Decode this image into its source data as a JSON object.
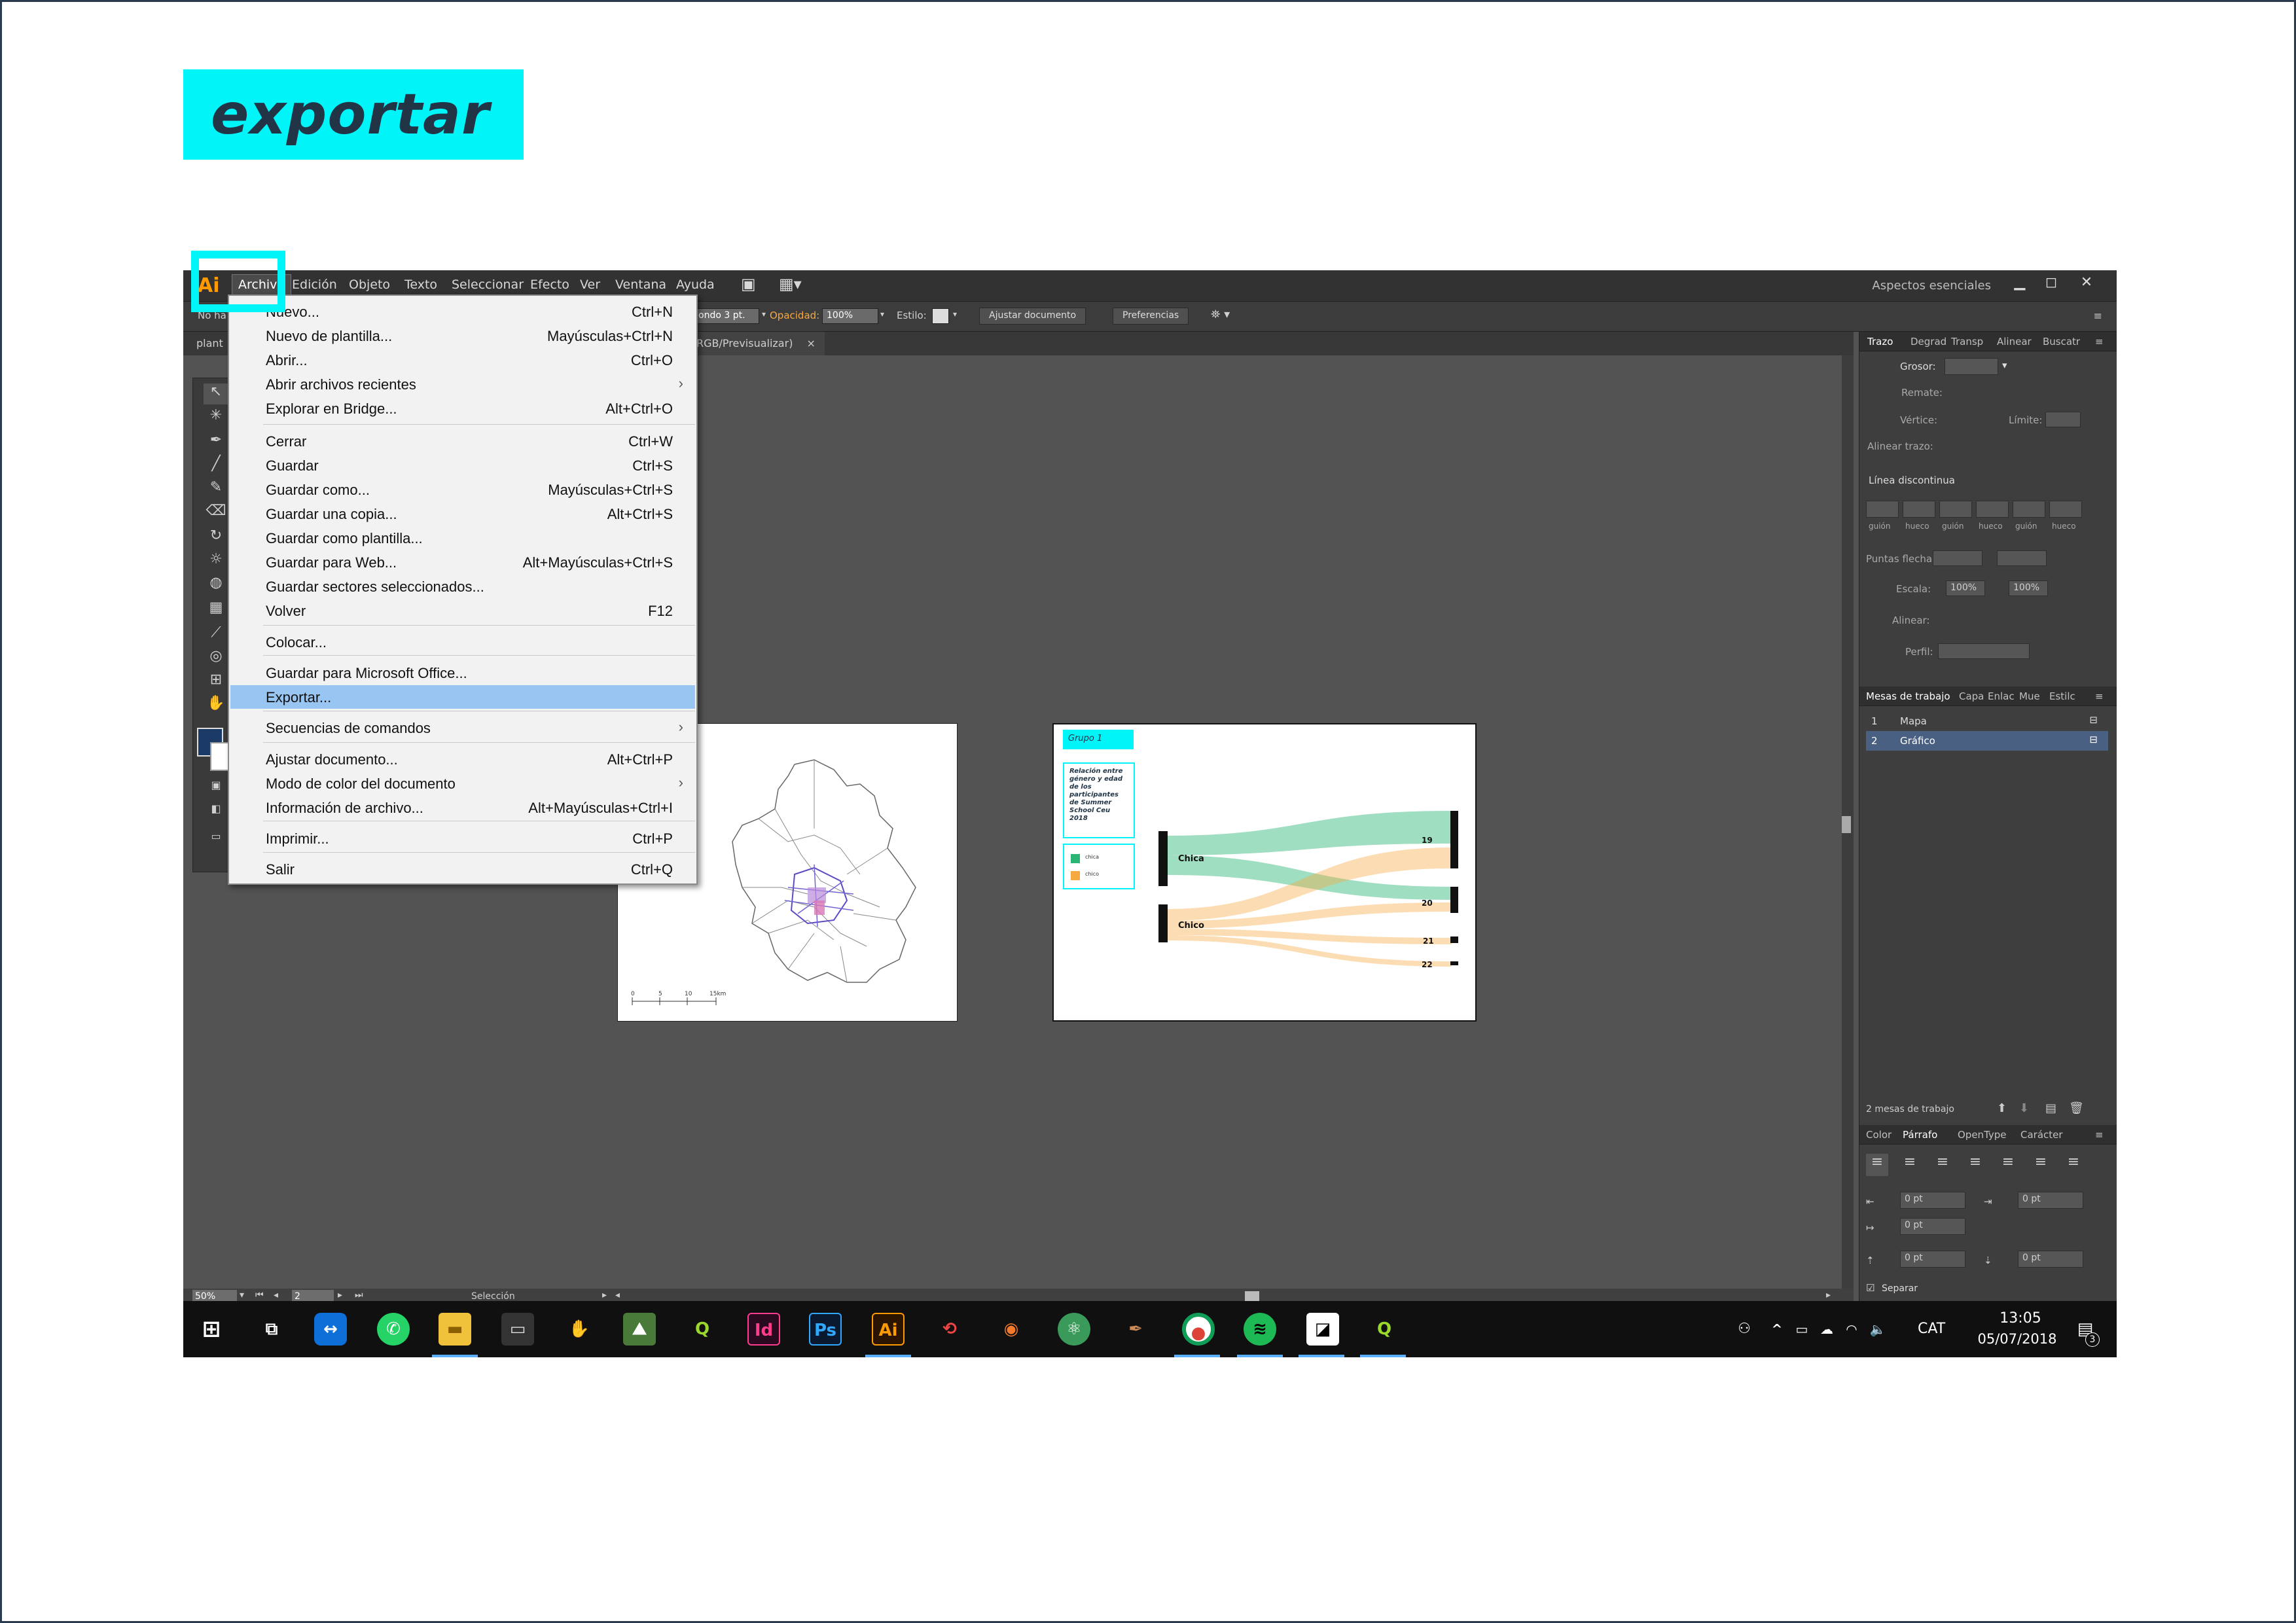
{
  "title": "exportar",
  "menubar": {
    "logo": "Ai",
    "items": [
      "Archivo",
      "Edición",
      "Objeto",
      "Texto",
      "Seleccionar",
      "Efecto",
      "Ver",
      "Ventana",
      "Ayuda"
    ],
    "workspace": "Aspectos esenciales"
  },
  "control_bar": {
    "left_label": "No ha",
    "stroke_value": "ondo 3 pt.",
    "opacity_label": "Opacidad:",
    "opacity_value": "100%",
    "style_label": "Estilo:",
    "fit_doc_button": "Ajustar documento",
    "prefs_button": "Preferencias"
  },
  "doc_tab": {
    "left_label": "plant",
    "title": "RGB/Previsualizar)",
    "close": "×"
  },
  "file_menu": [
    {
      "label": "Nuevo...",
      "shortcut": "Ctrl+N"
    },
    {
      "label": "Nuevo de plantilla...",
      "shortcut": "Mayúsculas+Ctrl+N"
    },
    {
      "label": "Abrir...",
      "shortcut": "Ctrl+O"
    },
    {
      "label": "Abrir archivos recientes",
      "shortcut": "",
      "submenu": true
    },
    {
      "label": "Explorar en Bridge...",
      "shortcut": "Alt+Ctrl+O"
    },
    {
      "label": "Cerrar",
      "shortcut": "Ctrl+W"
    },
    {
      "label": "Guardar",
      "shortcut": "Ctrl+S"
    },
    {
      "label": "Guardar como...",
      "shortcut": "Mayúsculas+Ctrl+S"
    },
    {
      "label": "Guardar una copia...",
      "shortcut": "Alt+Ctrl+S"
    },
    {
      "label": "Guardar como plantilla...",
      "shortcut": ""
    },
    {
      "label": "Guardar para Web...",
      "shortcut": "Alt+Mayúsculas+Ctrl+S"
    },
    {
      "label": "Guardar sectores seleccionados...",
      "shortcut": ""
    },
    {
      "label": "Volver",
      "shortcut": "F12"
    },
    {
      "label": "Colocar...",
      "shortcut": ""
    },
    {
      "label": "Guardar para Microsoft Office...",
      "shortcut": ""
    },
    {
      "label": "Exportar...",
      "shortcut": "",
      "highlight": true
    },
    {
      "label": "Secuencias de comandos",
      "shortcut": "",
      "submenu": true
    },
    {
      "label": "Ajustar documento...",
      "shortcut": "Alt+Ctrl+P"
    },
    {
      "label": "Modo de color del documento",
      "shortcut": "",
      "submenu": true
    },
    {
      "label": "Información de archivo...",
      "shortcut": "Alt+Mayúsculas+Ctrl+I"
    },
    {
      "label": "Imprimir...",
      "shortcut": "Ctrl+P"
    },
    {
      "label": "Salir",
      "shortcut": "Ctrl+Q"
    }
  ],
  "artboard1": {
    "scale_labels": [
      "0",
      "5",
      "10",
      "15km"
    ]
  },
  "artboard2": {
    "group_title": "Grupo 1",
    "description": "Relación entre género y edad de los participantes de Summer School Ceu 2018",
    "legend": [
      {
        "label": "chica",
        "color": "#2bb673"
      },
      {
        "label": "chico",
        "color": "#f7a941"
      }
    ],
    "sankey_sources": [
      "Chica",
      "Chico"
    ],
    "sankey_targets": [
      "19",
      "20",
      "21",
      "22"
    ]
  },
  "stroke_panel": {
    "tabs": [
      "Trazo",
      "Degrad",
      "Transp",
      "Alinear",
      "Buscatr"
    ],
    "weight_label": "Grosor:",
    "cap_label": "Remate:",
    "corner_label": "Vértice:",
    "limit_label": "Límite:",
    "align_label": "Alinear trazo:",
    "dashed_label": "Línea discontinua",
    "dash_labels": [
      "guión",
      "hueco",
      "guión",
      "hueco",
      "guión",
      "hueco"
    ],
    "arrow_label": "Puntas flecha:",
    "scale_label": "Escala:",
    "scale_values": [
      "100%",
      "100%"
    ],
    "align2_label": "Alinear:",
    "profile_label": "Perfil:"
  },
  "artboards_panel": {
    "tabs": [
      "Mesas de trabajo",
      "Capa",
      "Enlac",
      "Mue",
      "Estilc"
    ],
    "rows": [
      {
        "num": "1",
        "name": "Mapa"
      },
      {
        "num": "2",
        "name": "Gráfico"
      }
    ],
    "count": "2 mesas de trabajo"
  },
  "paragraph_panel": {
    "tabs": [
      "Color",
      "Párrafo",
      "OpenType",
      "Carácter"
    ],
    "fields": [
      "0 pt",
      "0 pt",
      "0 pt",
      "0 pt",
      "0 pt"
    ],
    "hyphenate": "Separar"
  },
  "statusbar": {
    "zoom": "50%",
    "page": "2",
    "tool": "Selección"
  },
  "taskbar": {
    "time": "13:05",
    "date": "05/07/2018",
    "lang": "CAT",
    "notif": "3"
  },
  "colors": {
    "accent": "#00f5f8",
    "menu_highlight": "#99c5f2",
    "chica": "#2bb673",
    "chico": "#f7a941"
  }
}
